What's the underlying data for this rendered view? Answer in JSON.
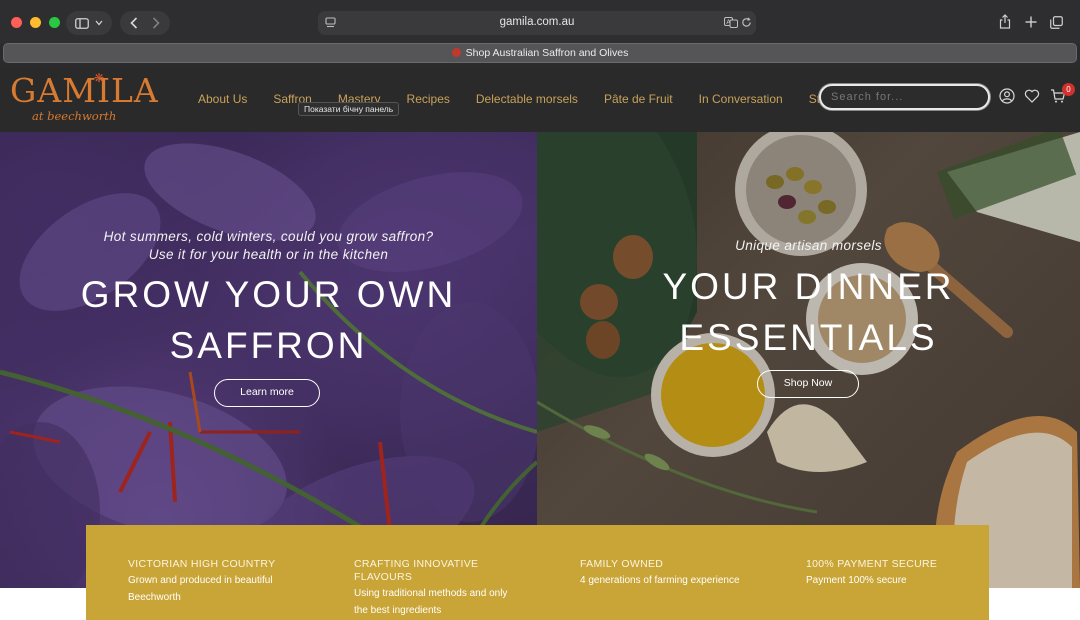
{
  "browser": {
    "url": "gamila.com.au",
    "tab_title": "Shop Australian Saffron and Olives"
  },
  "site": {
    "logo_text": "GAMILA",
    "logo_sub": "at beechworth",
    "nav": [
      "About Us",
      "Saffron",
      "Mastery",
      "Recipes",
      "Delectable morsels",
      "Pâte de Fruit",
      "In Conversation",
      "Stockists"
    ],
    "tooltip": "Показати бічну панель",
    "search_placeholder": "Search for...",
    "cart_count": "0"
  },
  "hero_left": {
    "subtitle_line1": "Hot summers, cold winters, could you grow saffron?",
    "subtitle_line2": "Use it for your health or in the kitchen",
    "title_line1": "GROW YOUR OWN",
    "title_line2": "SAFFRON",
    "button": "Learn more"
  },
  "hero_right": {
    "subtitle": "Unique artisan morsels",
    "title_line1": "YOUR DINNER",
    "title_line2": "ESSENTIALS",
    "button": "Shop Now"
  },
  "features": [
    {
      "title": "VICTORIAN HIGH COUNTRY",
      "text": "Grown and produced in beautiful Beechworth"
    },
    {
      "title": "CRAFTING INNOVATIVE FLAVOURS",
      "text": "Using traditional methods and only the best ingredients"
    },
    {
      "title": "FAMILY OWNED",
      "text": "4 generations of farming experience"
    },
    {
      "title": "100% PAYMENT SECURE",
      "text": "Payment 100% secure"
    }
  ],
  "colors": {
    "brand_orange": "#d77a32",
    "nav_gold": "#c8a25a",
    "feature_band": "#c9a436"
  }
}
